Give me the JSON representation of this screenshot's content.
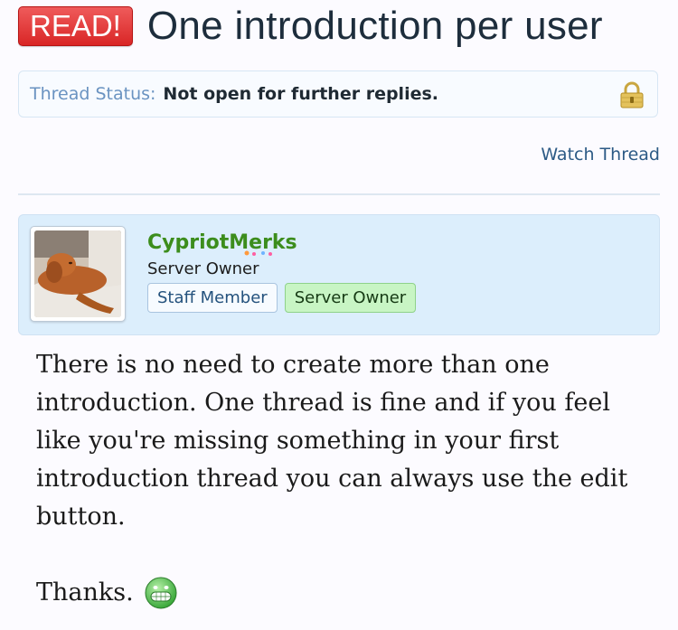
{
  "thread": {
    "prefix": "READ!",
    "title": "One introduction per user"
  },
  "status": {
    "label": "Thread Status:",
    "value": "Not open for further replies.",
    "icon": "lock-icon"
  },
  "actions": {
    "watch_label": "Watch Thread"
  },
  "post": {
    "author": {
      "username": "CypriotMerks",
      "title": "Server Owner",
      "avatar": "avatar-dog-photo",
      "badges": [
        "Staff Member",
        "Server Owner"
      ]
    },
    "body_paragraph": "There is no need to create more than one introduction. One thread is fine and if you feel like you're missing something in your first introduction thread you can always use the edit button.",
    "closing": "Thanks.",
    "smiley": "grin-smiley-icon"
  },
  "colors": {
    "read_badge": "#d92626",
    "username": "#3c8d1c",
    "panel_bg": "#dceefc",
    "link": "#2c5a85"
  }
}
